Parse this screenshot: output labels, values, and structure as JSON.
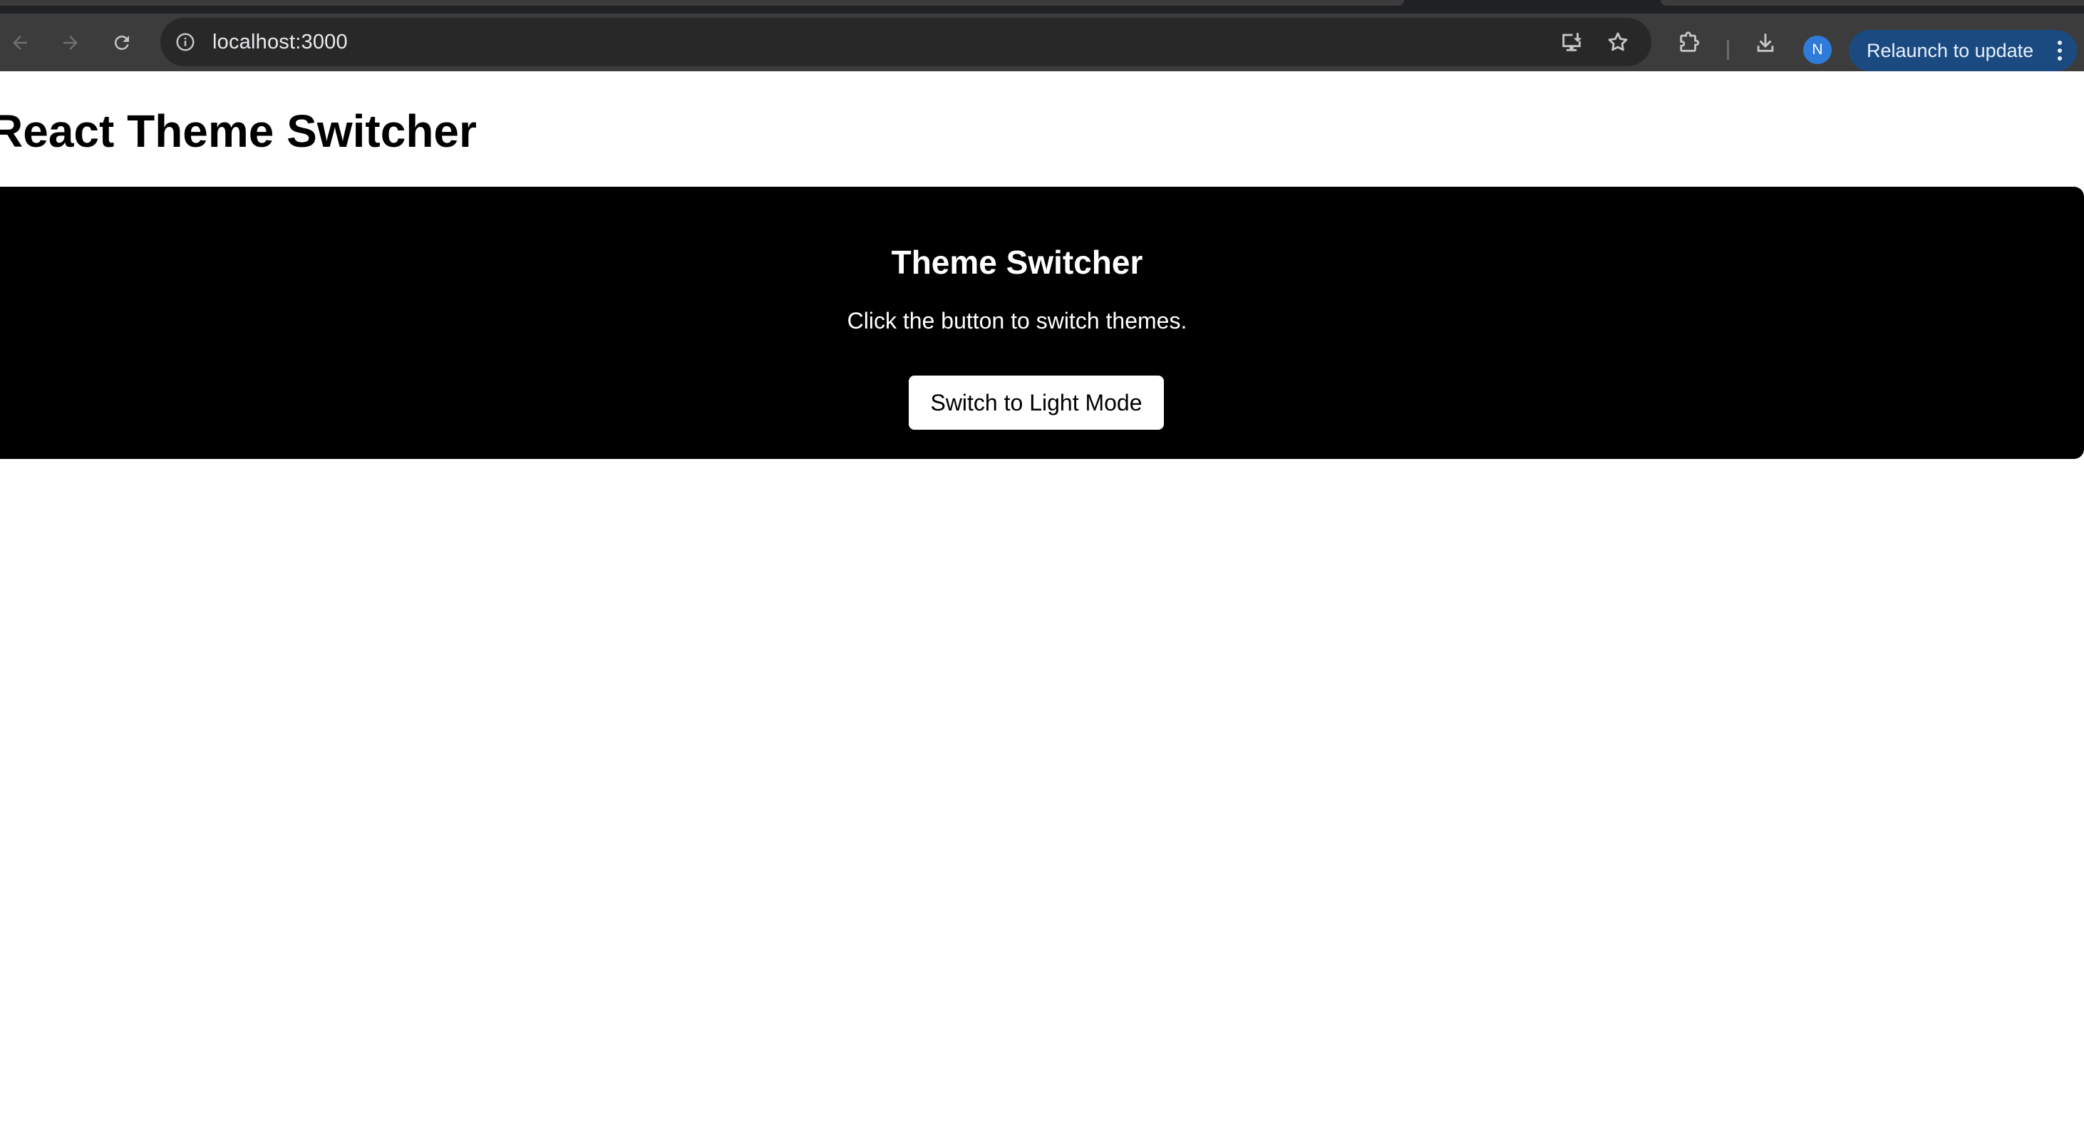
{
  "browser": {
    "url": "localhost:3000",
    "relaunch_label": "Relaunch to update",
    "profile_initial": "N",
    "icons": {
      "back": "back-arrow-icon",
      "forward": "forward-arrow-icon",
      "reload": "reload-icon",
      "site_info": "info-icon",
      "install": "install-app-icon",
      "bookmark": "star-icon",
      "extensions": "puzzle-icon",
      "downloads": "download-icon",
      "menu": "kebab-menu-icon"
    },
    "colors": {
      "toolbar": "#3c3c3c",
      "omnibox": "#282828",
      "relaunch_bg": "#1b4a80",
      "avatar": "#2f7bd9"
    }
  },
  "app": {
    "title": "React Theme Switcher",
    "card": {
      "heading": "Theme Switcher",
      "description": "Click the button to switch themes.",
      "button_label": "Switch to Light Mode",
      "theme": "dark",
      "background": "#000000",
      "text_color": "#ffffff"
    }
  }
}
